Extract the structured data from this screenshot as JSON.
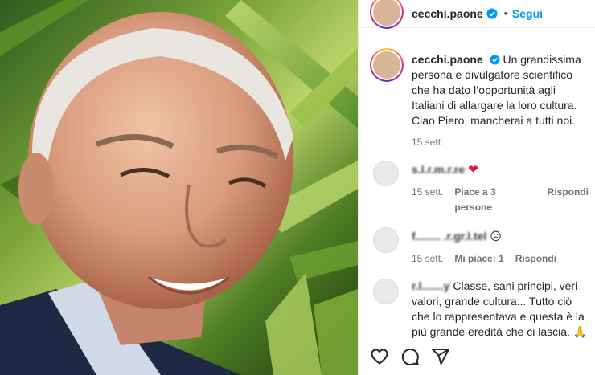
{
  "photo": {
    "alt_icon": "portrait-photo"
  },
  "header": {
    "username": "cecchi.paone",
    "dot": "•",
    "follow_label": "Segui"
  },
  "caption": {
    "username": "cecchi.paone",
    "text": "Un grandissima persona e divulgatore scientifico che ha dato l’opportunità agli Italiani di allargare la loro cultura.",
    "text2": "Ciao Piero, mancherai a tutti noi.",
    "time": "15 sett."
  },
  "comments": [
    {
      "username": "s.l.r.m.r.re",
      "emoji": "❤",
      "time": "15 sett.",
      "likes": "Piace a 3 persone",
      "reply": "Rispondi"
    },
    {
      "username": "f........ .r.gr.l.tel",
      "emoji": "😥",
      "time": "15 sett.",
      "likes": "Mi piace: 1",
      "reply": "Rispondi"
    },
    {
      "username": "r.l.......y",
      "text": "Classe, sani principi, veri valori, grande cultura... Tutto ciò che lo rappresentava e questa è la più grande eredità che ci lascia.",
      "emoji": "🙏"
    }
  ],
  "colors": {
    "accent": "#0095f6",
    "heart": "#e0143c",
    "meta": "#737373"
  }
}
